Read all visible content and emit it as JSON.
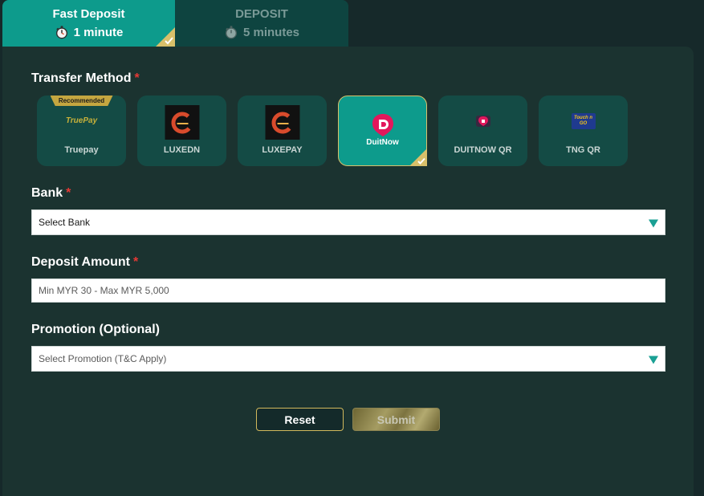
{
  "tabs": [
    {
      "title": "Fast Deposit",
      "time": "1 minute",
      "active": true
    },
    {
      "title": "DEPOSIT",
      "time": "5 minutes",
      "active": false
    }
  ],
  "transfer_method": {
    "label": "Transfer Method",
    "required_mark": "*",
    "methods": [
      {
        "name": "Truepay",
        "badge": "Recommended",
        "logo_text": "TruePay",
        "icon": "truepay-logo"
      },
      {
        "name": "LUXEDN",
        "icon": "luxedn-logo"
      },
      {
        "name": "LUXEPAY",
        "icon": "luxepay-logo"
      },
      {
        "name": "DuitNow",
        "logo_text": "DuitNow",
        "icon": "duitnow-logo",
        "selected": true
      },
      {
        "name": "DUITNOW QR",
        "icon": "duitnow-qr-logo"
      },
      {
        "name": "TNG QR",
        "logo_text": "Touch n GO",
        "icon": "tng-logo"
      }
    ]
  },
  "bank": {
    "label": "Bank",
    "required_mark": "*",
    "selected": "Select Bank"
  },
  "deposit_amount": {
    "label": "Deposit Amount",
    "required_mark": "*",
    "placeholder": "Min MYR 30 - Max MYR 5,000",
    "value": ""
  },
  "promotion": {
    "label": "Promotion (Optional)",
    "selected": "Select Promotion (T&C Apply)"
  },
  "buttons": {
    "reset": "Reset",
    "submit": "Submit"
  },
  "colors": {
    "accent": "#0d9b8c",
    "gold": "#d2b95c",
    "required": "#e53935",
    "panel": "#1b3330"
  }
}
